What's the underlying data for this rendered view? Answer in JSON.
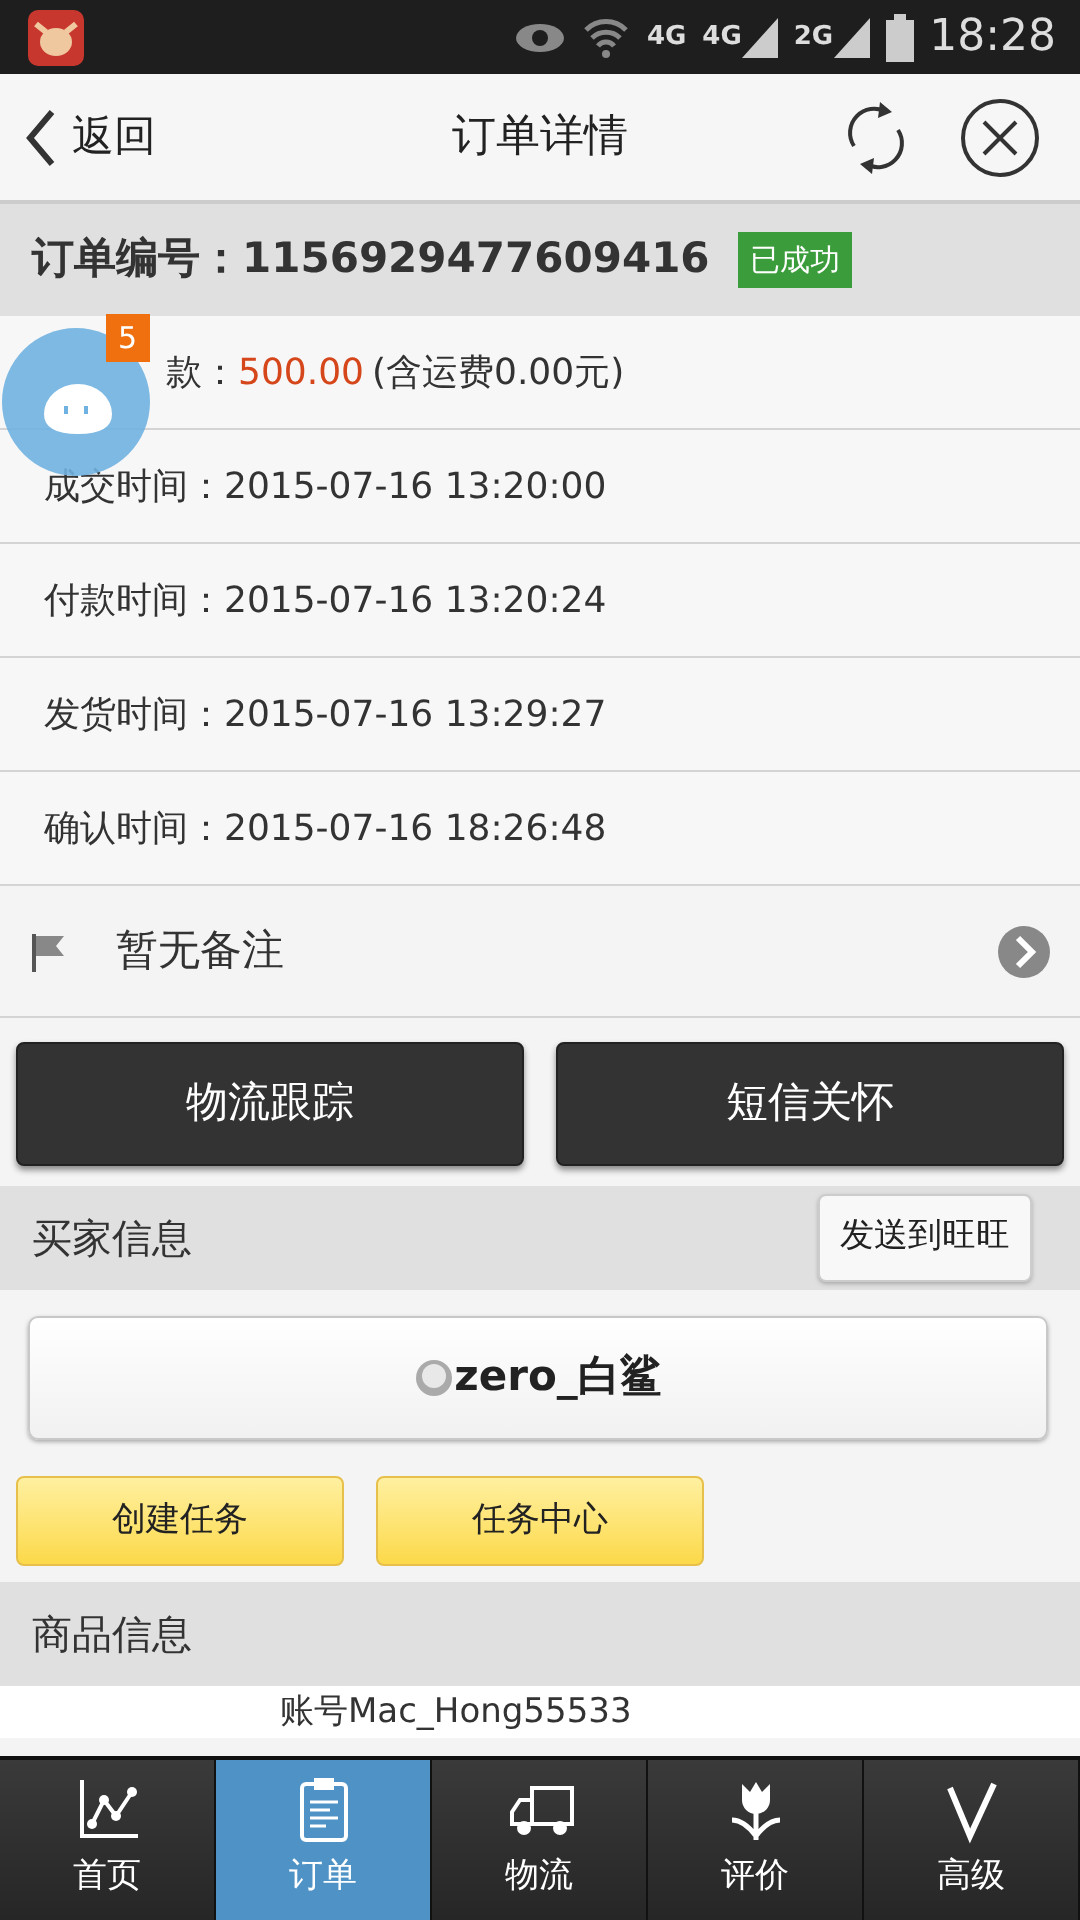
{
  "status_bar": {
    "network_labels": [
      "4G",
      "4G",
      "2G"
    ],
    "time": "18:28"
  },
  "header": {
    "back_label": "返回",
    "title": "订单详情"
  },
  "order": {
    "label": "订单编号：",
    "number": "1156929477609416",
    "status": "已成功"
  },
  "details": [
    {
      "kind": "amount",
      "label": "款：",
      "value": "500.00",
      "note": "(含运费0.00元)"
    },
    {
      "kind": "time",
      "label": "成交时间：",
      "value": "2015-07-16 13:20:00"
    },
    {
      "kind": "time",
      "label": "付款时间：",
      "value": "2015-07-16 13:20:24"
    },
    {
      "kind": "time",
      "label": "发货时间：",
      "value": "2015-07-16 13:29:27"
    },
    {
      "kind": "time",
      "label": "确认时间：",
      "value": "2015-07-16 18:26:48"
    }
  ],
  "floating_badge": "5",
  "remark": "暂无备注",
  "action_buttons": [
    "物流跟踪",
    "短信关怀"
  ],
  "buyer": {
    "title": "买家信息",
    "send_button": "发送到旺旺",
    "name": "zero_白鲨",
    "task_buttons": [
      "创建任务",
      "任务中心"
    ]
  },
  "goods": {
    "title": "商品信息",
    "first_line": "账号Mac_Hong55533"
  },
  "tabs": [
    {
      "label": "首页",
      "selected": false
    },
    {
      "label": "订单",
      "selected": true
    },
    {
      "label": "物流",
      "selected": false
    },
    {
      "label": "评价",
      "selected": false
    },
    {
      "label": "高级",
      "selected": false
    }
  ]
}
